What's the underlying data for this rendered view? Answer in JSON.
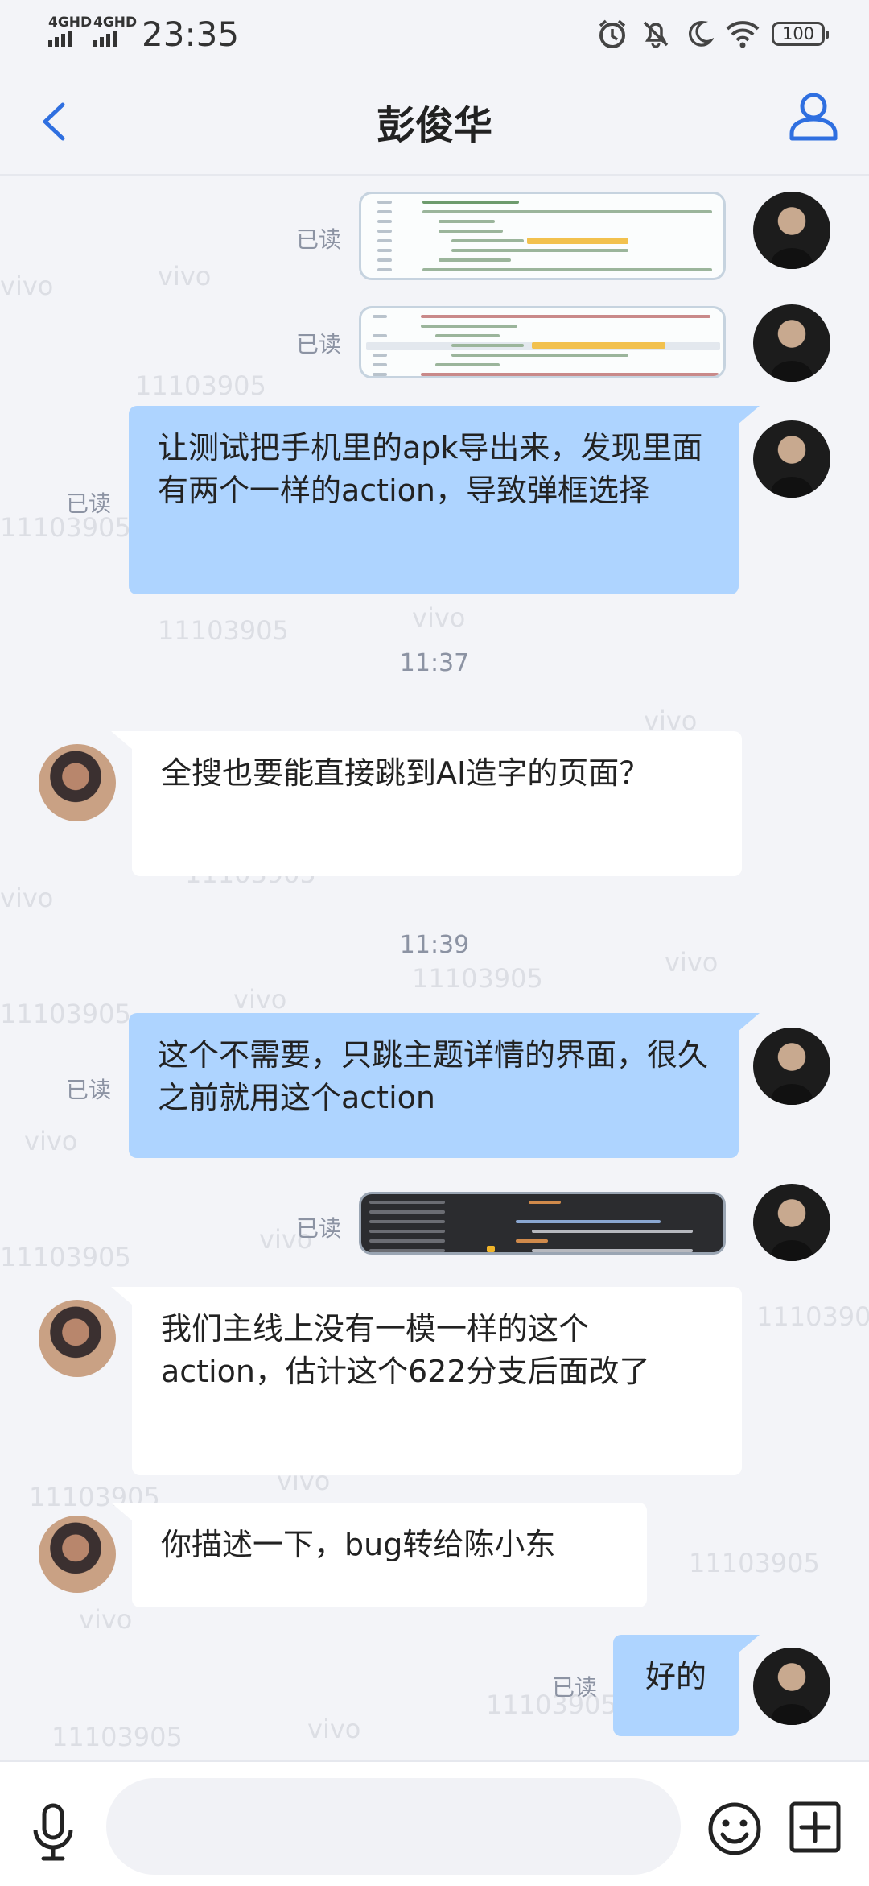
{
  "status_bar": {
    "network_1": "4GHD",
    "network_2": "4GHD",
    "time": "23:35",
    "battery": "100"
  },
  "header": {
    "title": "彭俊华",
    "back_icon": "chevron-left-icon",
    "contact_icon": "person-icon"
  },
  "watermark": {
    "text_1": "vivo",
    "text_2": "11103905"
  },
  "messages": {
    "m1": {
      "read": "已读",
      "type": "image"
    },
    "m2": {
      "read": "已读",
      "type": "image"
    },
    "m3": {
      "read": "已读",
      "text": "让测试把手机里的apk导出来，发现里面有两个一样的action，导致弹框选择"
    },
    "sep1": "11:37",
    "m4": {
      "text": "全搜也要能直接跳到AI造字的页面？"
    },
    "sep2": "11:39",
    "m5": {
      "read": "已读",
      "text": "这个不需要，只跳主题详情的界面，很久之前就用这个action"
    },
    "m6": {
      "read": "已读",
      "type": "image"
    },
    "m7": {
      "text": "我们主线上没有一模一样的这个action，估计这个622分支后面改了"
    },
    "m8": {
      "text": "你描述一下，bug转给陈小东"
    },
    "m9": {
      "read": "已读",
      "text": "好的"
    }
  },
  "composer": {
    "placeholder": "",
    "mic_icon": "microphone-icon",
    "emoji_icon": "emoji-icon",
    "plus_icon": "plus-square-icon"
  },
  "colors": {
    "outgoing_bubble": "#aed4ff",
    "incoming_bubble": "#ffffff",
    "accent": "#2f6fe0",
    "background": "#f3f4f8"
  }
}
